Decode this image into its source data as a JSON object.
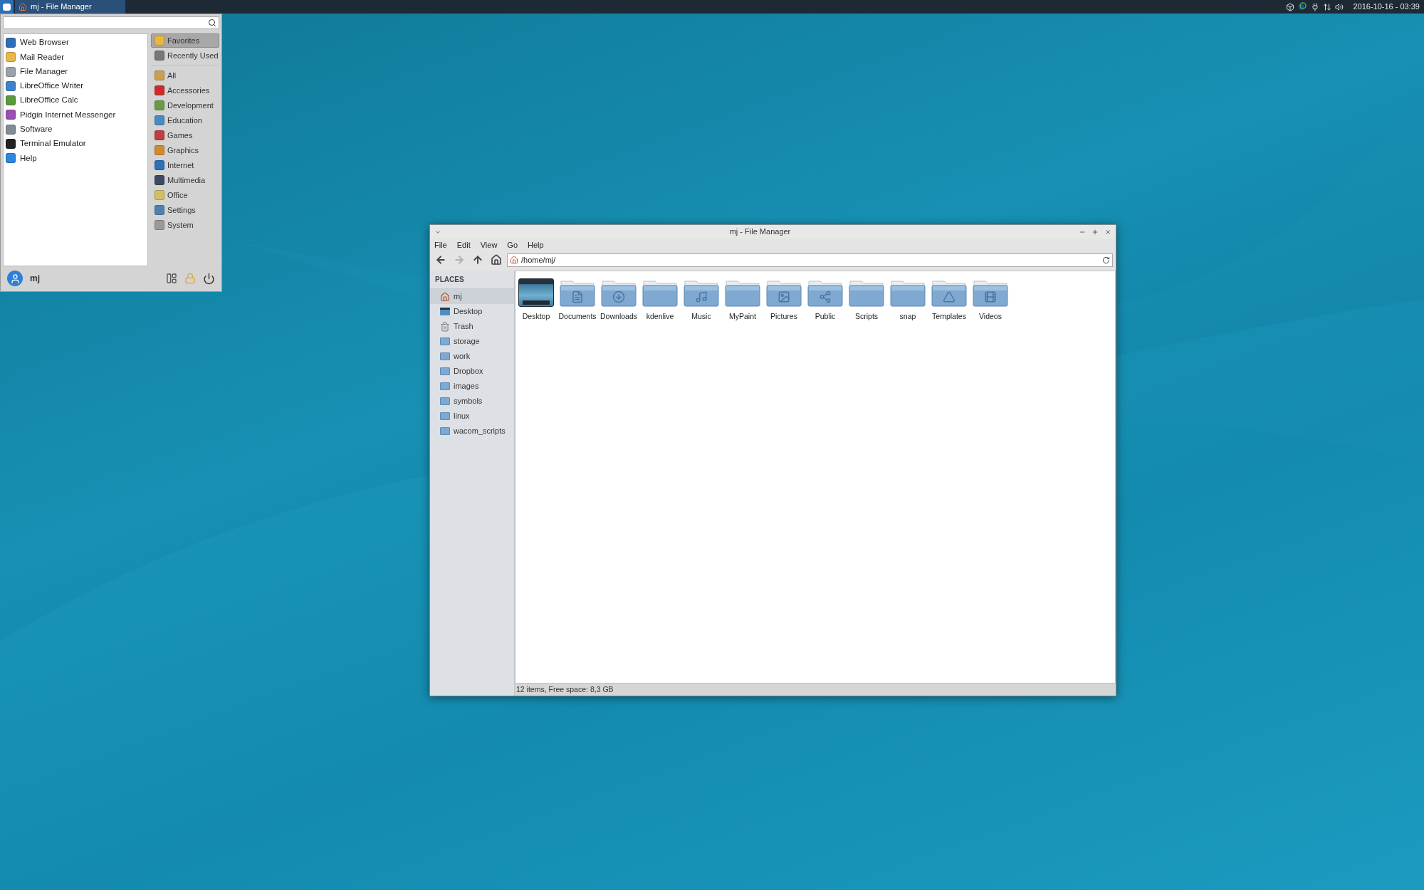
{
  "panel": {
    "tasks": [
      {
        "title": "mj - File Manager",
        "selected": true
      }
    ],
    "clock": "2016-10-16 - 03:39"
  },
  "app_menu": {
    "favorites": [
      "Web Browser",
      "Mail Reader",
      "File Manager",
      "LibreOffice Writer",
      "LibreOffice Calc",
      "Pidgin Internet Messenger",
      "Software",
      "Terminal Emulator",
      "Help"
    ],
    "categories": [
      {
        "label": "Favorites",
        "selected": true
      },
      {
        "label": "Recently Used",
        "selected": false
      },
      {
        "label": "All",
        "selected": false
      },
      {
        "label": "Accessories",
        "selected": false
      },
      {
        "label": "Development",
        "selected": false
      },
      {
        "label": "Education",
        "selected": false
      },
      {
        "label": "Games",
        "selected": false
      },
      {
        "label": "Graphics",
        "selected": false
      },
      {
        "label": "Internet",
        "selected": false
      },
      {
        "label": "Multimedia",
        "selected": false
      },
      {
        "label": "Office",
        "selected": false
      },
      {
        "label": "Settings",
        "selected": false
      },
      {
        "label": "System",
        "selected": false
      }
    ],
    "user": "mj"
  },
  "file_manager": {
    "title": "mj - File Manager",
    "menu": [
      "File",
      "Edit",
      "View",
      "Go",
      "Help"
    ],
    "nav": [
      {
        "kind": "back",
        "disabled": false
      },
      {
        "kind": "forward",
        "disabled": true
      },
      {
        "kind": "up",
        "disabled": false
      },
      {
        "kind": "home",
        "disabled": false
      }
    ],
    "path": "/home/mj/",
    "places_heading": "PLACES",
    "places": [
      {
        "label": "mj",
        "kind": "home",
        "selected": true
      },
      {
        "label": "Desktop",
        "kind": "desktop",
        "selected": false
      },
      {
        "label": "Trash",
        "kind": "trash",
        "selected": false
      },
      {
        "label": "storage",
        "kind": "folder",
        "selected": false
      },
      {
        "label": "work",
        "kind": "folder",
        "selected": false
      },
      {
        "label": "Dropbox",
        "kind": "folder",
        "selected": false
      },
      {
        "label": "images",
        "kind": "folder",
        "selected": false
      },
      {
        "label": "symbols",
        "kind": "folder",
        "selected": false
      },
      {
        "label": "linux",
        "kind": "folder",
        "selected": false
      },
      {
        "label": "wacom_scripts",
        "kind": "folder",
        "selected": false
      }
    ],
    "items": [
      {
        "label": "Desktop",
        "kind": "desktop"
      },
      {
        "label": "Documents",
        "kind": "folder"
      },
      {
        "label": "Downloads",
        "kind": "folder"
      },
      {
        "label": "kdenlive",
        "kind": "folder"
      },
      {
        "label": "Music",
        "kind": "folder"
      },
      {
        "label": "MyPaint",
        "kind": "folder"
      },
      {
        "label": "Pictures",
        "kind": "folder"
      },
      {
        "label": "Public",
        "kind": "folder"
      },
      {
        "label": "Scripts",
        "kind": "folder"
      },
      {
        "label": "snap",
        "kind": "folder"
      },
      {
        "label": "Templates",
        "kind": "folder"
      },
      {
        "label": "Videos",
        "kind": "folder"
      }
    ],
    "status": "12 items, Free space: 8,3 GB"
  }
}
